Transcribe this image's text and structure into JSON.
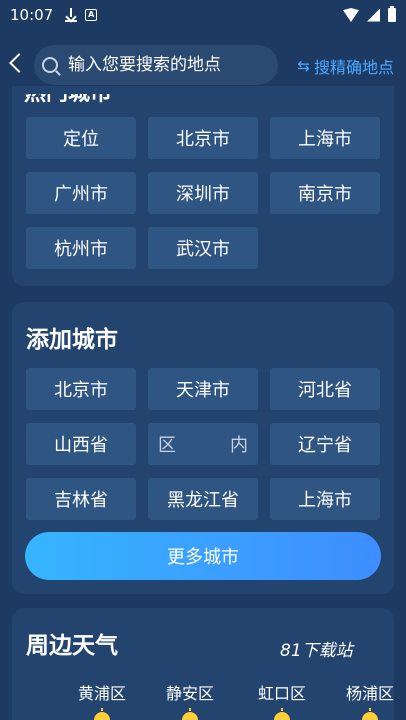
{
  "status_bar": {
    "time": "10:07",
    "icons": [
      "download-icon",
      "a-icon",
      "wifi-icon",
      "signal-icon",
      "battery-icon"
    ]
  },
  "search": {
    "placeholder": "输入您要搜索的地点",
    "value": "",
    "precise_label": "搜精确地点",
    "precise_icon": "⇆"
  },
  "hot_cities": {
    "title": "热门城市",
    "cities": [
      "定位",
      "北京市",
      "上海市",
      "广州市",
      "深圳市",
      "南京市",
      "杭州市",
      "武汉市"
    ]
  },
  "add_city": {
    "title": "添加城市",
    "cities": [
      "北京市",
      "天津市",
      "河北省",
      "山西省",
      "区",
      "内",
      "辽宁省",
      "吉林省",
      "黑龙江省",
      "上海市"
    ],
    "more_label": "更多城市"
  },
  "nearby_weather": {
    "title": "周边天气",
    "watermark": "81下载站",
    "districts": [
      "黄浦区",
      "静安区",
      "虹口区",
      "杨浦区"
    ]
  },
  "colors": {
    "background": "#1c3a62",
    "card": "#22446e",
    "city_button": "#2f5583",
    "accent": "#4ea8ff",
    "more_button_start": "#36b5ff",
    "more_button_end": "#3f8dff",
    "sun": "#ffcf3a"
  }
}
